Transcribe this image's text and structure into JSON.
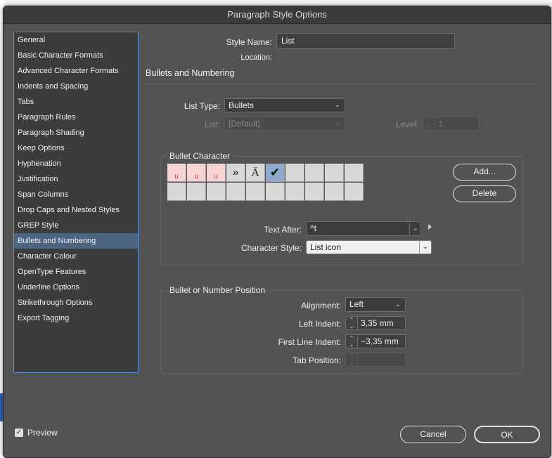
{
  "dialog": {
    "title": "Paragraph Style Options"
  },
  "sidebar": {
    "items": [
      {
        "label": "General"
      },
      {
        "label": "Basic Character Formats"
      },
      {
        "label": "Advanced Character Formats"
      },
      {
        "label": "Indents and Spacing"
      },
      {
        "label": "Tabs"
      },
      {
        "label": "Paragraph Rules"
      },
      {
        "label": "Paragraph Shading"
      },
      {
        "label": "Keep Options"
      },
      {
        "label": "Hyphenation"
      },
      {
        "label": "Justification"
      },
      {
        "label": "Span Columns"
      },
      {
        "label": "Drop Caps and Nested Styles"
      },
      {
        "label": "GREP Style"
      },
      {
        "label": "Bullets and Numbering",
        "active": true
      },
      {
        "label": "Character Colour"
      },
      {
        "label": "OpenType Features"
      },
      {
        "label": "Underline Options"
      },
      {
        "label": "Strikethrough Options"
      },
      {
        "label": "Export Tagging"
      }
    ]
  },
  "header": {
    "style_name_label": "Style Name:",
    "style_name_value": "List",
    "location_label": "Location:",
    "section_title": "Bullets and Numbering"
  },
  "list": {
    "type_label": "List Type:",
    "type_value": "Bullets",
    "list_label": "List:",
    "list_value": "[Default]",
    "level_label": "Level:",
    "level_value": "1"
  },
  "bullet_character": {
    "title": "Bullet Character",
    "glyphs": [
      "u",
      "u",
      "u",
      "»",
      "Ä",
      "✔"
    ],
    "add_label": "Add...",
    "delete_label": "Delete",
    "text_after_label": "Text After:",
    "text_after_value": "^t",
    "character_style_label": "Character Style:",
    "character_style_value": "List icon"
  },
  "position": {
    "title": "Bullet or Number Position",
    "alignment_label": "Alignment:",
    "alignment_value": "Left",
    "left_indent_label": "Left Indent:",
    "left_indent_value": "3,35 mm",
    "first_line_indent_label": "First Line Indent:",
    "first_line_indent_value": "−3,35 mm",
    "tab_position_label": "Tab Position:",
    "tab_position_value": ""
  },
  "footer": {
    "preview_label": "Preview",
    "preview_checked": true,
    "cancel_label": "Cancel",
    "ok_label": "OK"
  },
  "icons": {
    "checkmark": "checkmark-icon",
    "chevron": "chevron-down-icon",
    "stepper": "stepper-icon"
  },
  "colors": {
    "dialog_bg": "#535353",
    "sidebar_bg": "#3c3c3c",
    "selection": "#4b6482",
    "focus_border": "#5d8fd6"
  }
}
